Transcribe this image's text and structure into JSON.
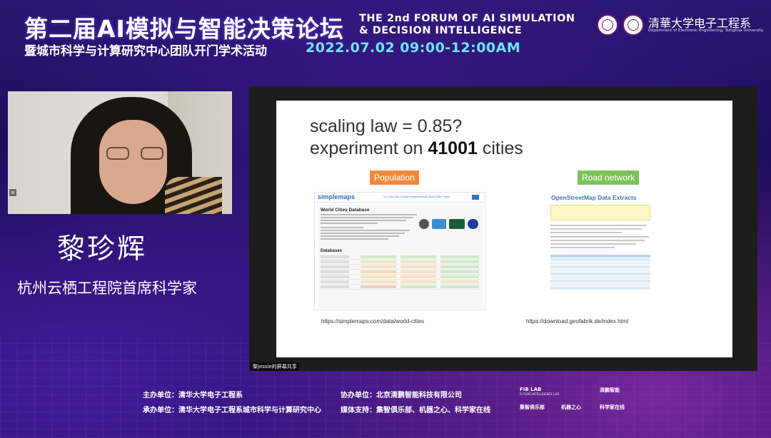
{
  "header": {
    "title_cn": "第二届AI模拟与智能决策论坛",
    "title_en_line1": "THE 2nd FORUM OF AI SIMULATION",
    "title_en_line2": "& DECISION INTELLIGENCE",
    "subtitle_cn": "暨城市科学与计算研究中心团队开门学术活动",
    "datetime": "2022.07.02  09:00-12:00AM",
    "dept_cn": "清華大学电子工程系",
    "dept_en": "Department of Electronic Engineering, Tsinghua University"
  },
  "speaker": {
    "name": "黎珍辉",
    "title": "杭州云栖工程院首席科学家",
    "video_menu_glyph": "≡"
  },
  "screen_share": {
    "label": "黎jessie的屏幕共享",
    "slide": {
      "line1": "scaling law = 0.85?",
      "line2_prefix": "experiment on ",
      "line2_number": "41001",
      "line2_suffix": " cities",
      "label_left": "Population",
      "label_right": "Road network",
      "url_left": "https://simplemaps.com/data/world-cities",
      "url_right": "https://download.geofabrik.de/index.html",
      "simplemaps": {
        "logo": "simplemaps",
        "nav_links": "US Cities   Zips   Counties   Neighborhoods   World Cities   Pricing",
        "heading": "World Cities Database",
        "databases": "Databases"
      },
      "geofabrik": {
        "title": "OpenStreetMap Data Extracts"
      }
    }
  },
  "footer": {
    "host": "主办单位：清华大学电子工程系",
    "co_org": "协办单位：北京清鹏智能科技有限公司",
    "organizer": "承办单位：清华大学电子工程系城市科学与计算研究中心",
    "media": "媒体支持：集智俱乐部、机器之心、科学家在线",
    "partners": {
      "fib_lab": "FIB LAB",
      "fib_lab_sub": "FUTURE INTELLIGENCE LAB",
      "qingpeng": "清鹏智能",
      "jizhi": "集智俱乐部",
      "jiqizhixin": "机器之心",
      "kexuejia": "科学家在线"
    }
  },
  "colors": {
    "date_accent": "#6fe3ff",
    "population_label": "#f08a3a",
    "road_label": "#7cc35a"
  }
}
